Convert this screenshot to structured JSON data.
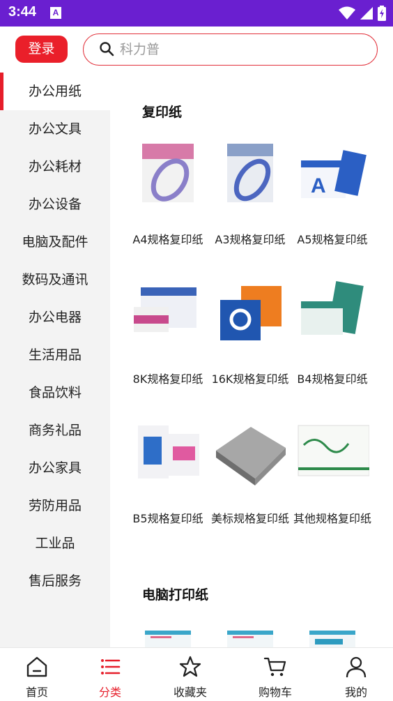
{
  "status": {
    "time": "3:44",
    "notif_glyph": "A"
  },
  "header": {
    "login_label": "登录",
    "search_placeholder": "科力普"
  },
  "sidebar": {
    "items": [
      {
        "label": "办公用纸",
        "active": true
      },
      {
        "label": "办公文具"
      },
      {
        "label": "办公耗材"
      },
      {
        "label": "办公设备"
      },
      {
        "label": "电脑及配件"
      },
      {
        "label": "数码及通讯"
      },
      {
        "label": "办公电器"
      },
      {
        "label": "生活用品"
      },
      {
        "label": "食品饮料"
      },
      {
        "label": "商务礼品"
      },
      {
        "label": "办公家具"
      },
      {
        "label": "劳防用品"
      },
      {
        "label": "工业品"
      },
      {
        "label": "售后服务"
      }
    ]
  },
  "sections": [
    {
      "title": "复印纸",
      "products": [
        {
          "name": "A4规格复印纸",
          "thumb_color": "#d77aa8"
        },
        {
          "name": "A3规格复印纸",
          "thumb_color": "#8aa0c8"
        },
        {
          "name": "A5规格复印纸",
          "thumb_color": "#2b5fc4"
        },
        {
          "name": "8K规格复印纸",
          "thumb_color": "#3a63b8"
        },
        {
          "name": "16K规格复印纸",
          "thumb_color": "#ee7d20"
        },
        {
          "name": "B4规格复印纸",
          "thumb_color": "#2f8c7c"
        },
        {
          "name": "B5规格复印纸",
          "thumb_color": "#2e6ec8"
        },
        {
          "name": "美标规格复印纸",
          "thumb_color": "#8c8c8c"
        },
        {
          "name": "其他规格复印纸",
          "thumb_color": "#2d8a4a"
        }
      ]
    },
    {
      "title": "电脑打印纸",
      "products": [
        {
          "name": "",
          "thumb_color": "#3aa6c9"
        },
        {
          "name": "",
          "thumb_color": "#3aa6c9"
        },
        {
          "name": "",
          "thumb_color": "#3aa6c9"
        }
      ]
    }
  ],
  "bottom_nav": [
    {
      "label": "首页",
      "icon": "home-icon"
    },
    {
      "label": "分类",
      "icon": "category-list-icon",
      "active": true
    },
    {
      "label": "收藏夹",
      "icon": "star-icon"
    },
    {
      "label": "购物车",
      "icon": "cart-icon"
    },
    {
      "label": "我的",
      "icon": "person-icon"
    }
  ],
  "colors": {
    "accent": "#e61e2a",
    "status_bar": "#6a1fd0"
  }
}
